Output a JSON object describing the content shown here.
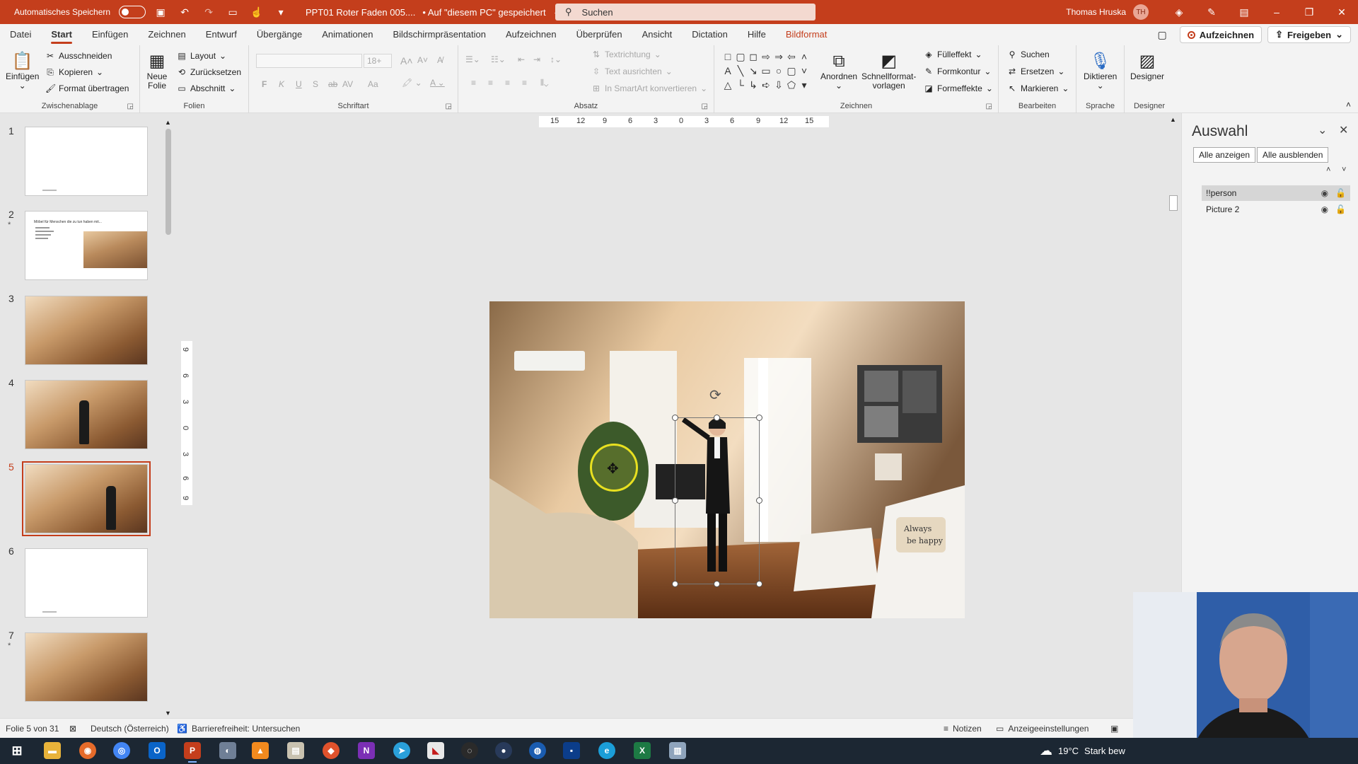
{
  "titlebar": {
    "autosave_label": "Automatisches Speichern",
    "doc_title": "PPT01 Roter Faden 005....",
    "save_status": "• Auf \"diesem PC\" gespeichert",
    "search_placeholder": "Suchen",
    "user_name": "Thomas Hruska",
    "user_initials": "TH"
  },
  "tabs": [
    "Datei",
    "Start",
    "Einfügen",
    "Zeichnen",
    "Entwurf",
    "Übergänge",
    "Animationen",
    "Bildschirmpräsentation",
    "Aufzeichnen",
    "Überprüfen",
    "Ansicht",
    "Dictation",
    "Hilfe",
    "Bildformat"
  ],
  "tab_actions": {
    "record": "Aufzeichnen",
    "share": "Freigeben"
  },
  "ribbon": {
    "clipboard": {
      "label": "Zwischenablage",
      "paste": "Einfügen",
      "cut": "Ausschneiden",
      "copy": "Kopieren",
      "format_painter": "Format übertragen"
    },
    "slides": {
      "label": "Folien",
      "new_slide_1": "Neue",
      "new_slide_2": "Folie",
      "layout": "Layout",
      "reset": "Zurücksetzen",
      "section": "Abschnitt"
    },
    "font": {
      "label": "Schriftart",
      "size": "18+",
      "bold": "F",
      "italic": "K",
      "underline": "U",
      "strike": "S",
      "spacing": "AV",
      "case": "Aa"
    },
    "paragraph": {
      "label": "Absatz",
      "text_direction": "Textrichtung",
      "align_text": "Text ausrichten",
      "smartart": "In SmartArt konvertieren"
    },
    "drawing": {
      "label": "Zeichnen",
      "arrange": "Anordnen",
      "quick_styles_1": "Schnellformat-",
      "quick_styles_2": "vorlagen",
      "fill": "Fülleffekt",
      "outline": "Formkontur",
      "effects": "Formeffekte"
    },
    "editing": {
      "label": "Bearbeiten",
      "find": "Suchen",
      "replace": "Ersetzen",
      "select": "Markieren"
    },
    "voice": {
      "label": "Sprache",
      "dictate": "Diktieren"
    },
    "designer": {
      "label": "Designer",
      "designer": "Designer"
    }
  },
  "slides": [
    {
      "num": "1",
      "star": "",
      "kind": "blank"
    },
    {
      "num": "2",
      "star": "*",
      "kind": "text-photo",
      "heading": "Möbel für Menschen die zu tun haben mit..."
    },
    {
      "num": "3",
      "star": "",
      "kind": "photo"
    },
    {
      "num": "4",
      "star": "",
      "kind": "photo-person"
    },
    {
      "num": "5",
      "star": "",
      "kind": "photo-person",
      "selected": true
    },
    {
      "num": "6",
      "star": "",
      "kind": "blank"
    },
    {
      "num": "7",
      "star": "*",
      "kind": "photo"
    }
  ],
  "rulers": {
    "horizontal": [
      "15",
      "12",
      "9",
      "6",
      "3",
      "0",
      "3",
      "6",
      "9",
      "12",
      "15"
    ],
    "vertical": [
      "9",
      "6",
      "3",
      "0",
      "3",
      "6",
      "9"
    ]
  },
  "selection_pane": {
    "title": "Auswahl",
    "show_all": "Alle anzeigen",
    "hide_all": "Alle ausblenden",
    "items": [
      {
        "name": "!!person",
        "selected": true
      },
      {
        "name": "Picture 2",
        "selected": false
      }
    ]
  },
  "status": {
    "slide_info": "Folie 5 von 31",
    "language": "Deutsch (Österreich)",
    "accessibility": "Barrierefreiheit: Untersuchen",
    "notes": "Notizen",
    "display_settings": "Anzeigeeinstellungen"
  },
  "taskbar": {
    "temperature": "19°C",
    "weather": "Stark bew"
  },
  "colors": {
    "accent": "#c43e1c",
    "ribbon_bg": "#f3f3f3",
    "canvas_bg": "#e6e6e6",
    "taskbar_bg": "#1c2733"
  }
}
